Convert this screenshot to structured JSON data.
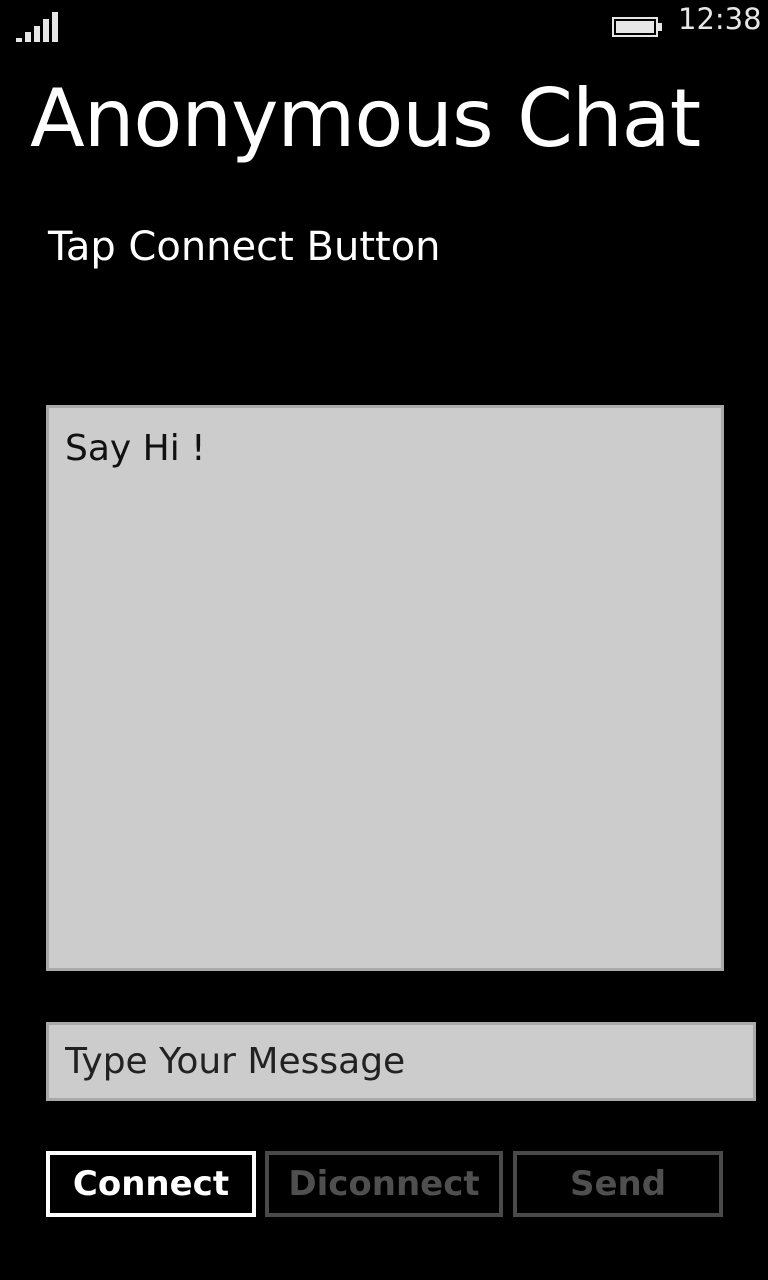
{
  "status_bar": {
    "signal_icon": "signal-strength-icon",
    "battery_icon": "battery-icon",
    "time": "12:38"
  },
  "app": {
    "title": "Anonymous Chat",
    "status_text": "Tap Connect Button"
  },
  "chat": {
    "log_text": "Say Hi !"
  },
  "message": {
    "placeholder": "Type Your Message",
    "value": ""
  },
  "buttons": {
    "connect_label": "Connect",
    "disconnect_label": "Diconnect",
    "send_label": "Send"
  },
  "colors": {
    "background": "#000000",
    "panel": "#cccccc",
    "panel_border": "#a9a9a9",
    "enabled_button": "#ffffff",
    "disabled_button": "#4a4a4a"
  }
}
